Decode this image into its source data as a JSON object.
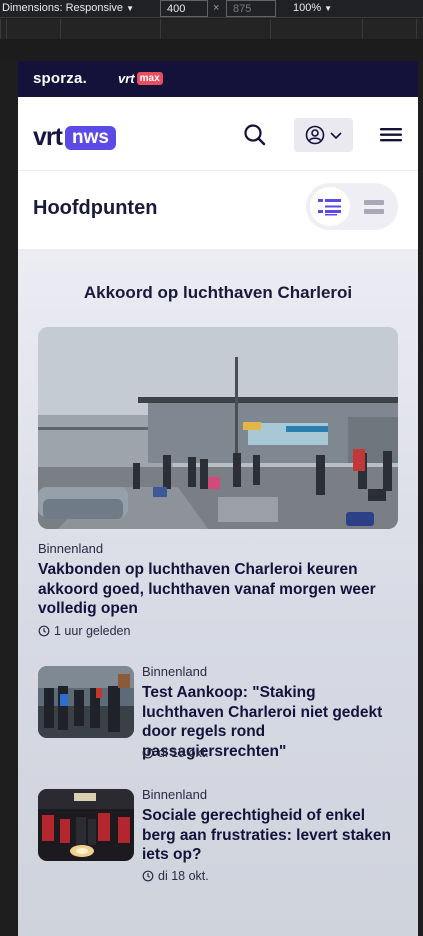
{
  "devtools": {
    "dimensions_label": "Dimensions: Responsive",
    "width_value": "400",
    "height_value": "875",
    "times": "×",
    "zoom": "100%"
  },
  "brandbar": {
    "sporza": "sporza",
    "vrt": "vrt",
    "max": "max"
  },
  "navbar": {
    "logo_vrt": "vrt",
    "logo_nws": "nws"
  },
  "section": {
    "title": "Hoofdpunten"
  },
  "feed": {
    "topic": "Akkoord op luchthaven Charleroi",
    "hero": {
      "category": "Binnenland",
      "headline": "Vakbonden op luchthaven Charleroi keuren akkoord goed, luchthaven vanaf morgen weer volledig open",
      "time": "1 uur geleden"
    },
    "items": [
      {
        "category": "Binnenland",
        "headline": "Test Aankoop: \"Staking luchthaven Charleroi niet gedekt door regels rond passagiersrechten\"",
        "time": "di 18 okt."
      },
      {
        "category": "Binnenland",
        "headline": "Sociale gerechtigheid of enkel berg aan frustraties: levert staken iets op?",
        "time": "di 18 okt."
      }
    ]
  },
  "colors": {
    "brandbar": "#14123b",
    "accent": "#5b4ae6",
    "max_badge": "#e94e5f"
  },
  "icons": [
    "search-icon",
    "user-icon",
    "chevron-down-icon",
    "menu-icon",
    "list-view-icon",
    "compact-view-icon",
    "clock-icon"
  ]
}
